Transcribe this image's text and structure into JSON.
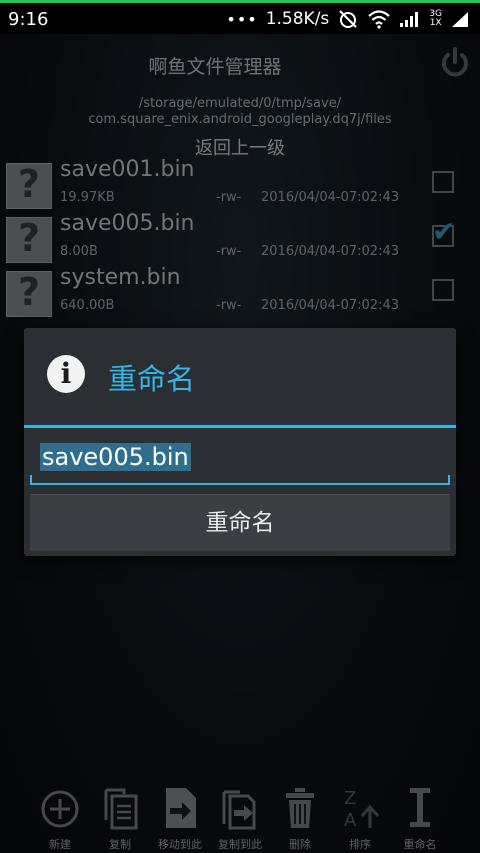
{
  "status_bar": {
    "time": "9:16",
    "speed": "1.58K/s",
    "network_top": "3G",
    "network_bottom": "1X"
  },
  "app": {
    "title": "啊鱼文件管理器",
    "path_line1": "/storage/emulated/0/tmp/save/",
    "path_line2": "com.square_enix.android_googleplay.dq7j/files",
    "back_label": "返回上一级"
  },
  "files": [
    {
      "name": "save001.bin",
      "size": "19.97KB",
      "perm": "-rw-",
      "date": "2016/04/04-07:02:43",
      "checked": false,
      "icon": "question-mark-file-icon"
    },
    {
      "name": "save005.bin",
      "size": "8.00B",
      "perm": "-rw-",
      "date": "2016/04/04-07:02:43",
      "checked": true,
      "icon": "question-mark-file-icon"
    },
    {
      "name": "system.bin",
      "size": "640.00B",
      "perm": "-rw-",
      "date": "2016/04/04-07:02:43",
      "checked": false,
      "icon": "question-mark-file-icon"
    }
  ],
  "dialog": {
    "icon": "info-icon",
    "title": "重命名",
    "input_value": "save005.bin",
    "button_label": "重命名"
  },
  "toolbar": [
    {
      "label": "新建",
      "icon": "add-circle-icon"
    },
    {
      "label": "复制",
      "icon": "copy-icon"
    },
    {
      "label": "移动到此",
      "icon": "move-here-icon"
    },
    {
      "label": "复制到此",
      "icon": "copy-here-icon"
    },
    {
      "label": "删除",
      "icon": "trash-icon"
    },
    {
      "label": "排序",
      "icon": "sort-az-icon"
    },
    {
      "label": "重命名",
      "icon": "rename-cursor-icon"
    }
  ],
  "colors": {
    "accent": "#33b5e5",
    "statusbar_line": "#23c552"
  }
}
